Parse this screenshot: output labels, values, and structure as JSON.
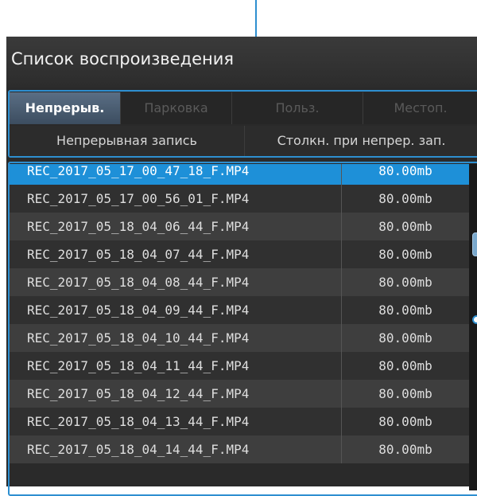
{
  "window": {
    "title": "Список воспроизведения"
  },
  "tabs": [
    {
      "label": "Непрерыв.",
      "active": true
    },
    {
      "label": "Парковка",
      "active": false
    },
    {
      "label": "Польз.",
      "active": false
    },
    {
      "label": "Местоп.",
      "active": false
    }
  ],
  "subtabs": [
    {
      "label": "Непрерывная запись"
    },
    {
      "label": "Столкн. при непрер. зап."
    }
  ],
  "files": [
    {
      "name": "REC_2017_05_17_00_47_18_F.MP4",
      "size": "80.00mb",
      "selected": true
    },
    {
      "name": "REC_2017_05_17_00_56_01_F.MP4",
      "size": "80.00mb"
    },
    {
      "name": "REC_2017_05_18_04_06_44_F.MP4",
      "size": "80.00mb"
    },
    {
      "name": "REC_2017_05_18_04_07_44_F.MP4",
      "size": "80.00mb"
    },
    {
      "name": "REC_2017_05_18_04_08_44_F.MP4",
      "size": "80.00mb"
    },
    {
      "name": "REC_2017_05_18_04_09_44_F.MP4",
      "size": "80.00mb"
    },
    {
      "name": "REC_2017_05_18_04_10_44_F.MP4",
      "size": "80.00mb"
    },
    {
      "name": "REC_2017_05_18_04_11_44_F.MP4",
      "size": "80.00mb"
    },
    {
      "name": "REC_2017_05_18_04_12_44_F.MP4",
      "size": "80.00mb"
    },
    {
      "name": "REC_2017_05_18_04_13_44_F.MP4",
      "size": "80.00mb"
    },
    {
      "name": "REC_2017_05_18_04_14_44_F.MP4",
      "size": "80.00mb"
    }
  ],
  "colors": {
    "accent": "#2e8fd0",
    "selection": "#1e90d8",
    "active_tab": "#4a5d72",
    "background": "#2a2a2a"
  }
}
